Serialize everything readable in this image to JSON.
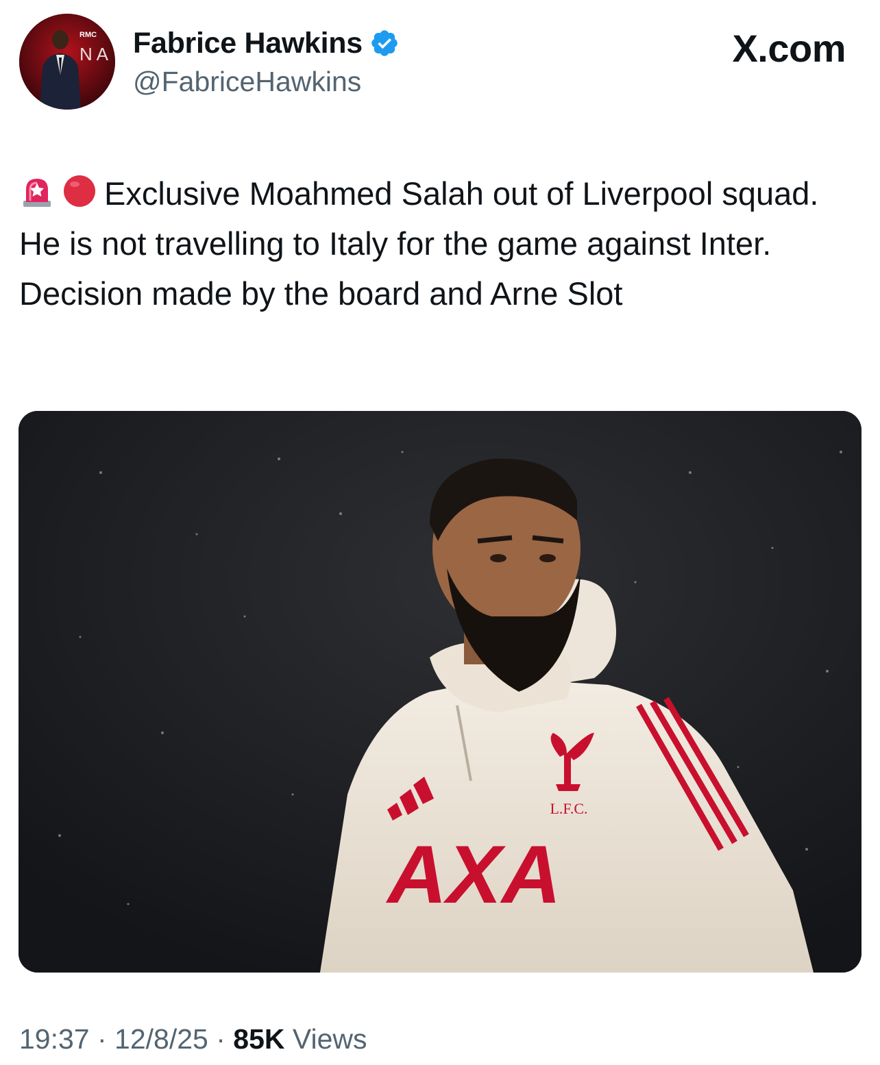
{
  "header": {
    "display_name": "Fabrice Hawkins",
    "handle": "@FabriceHawkins",
    "brand": "X.com",
    "avatar_sign_text": "N A",
    "avatar_logo_text": "RMC"
  },
  "tweet": {
    "text": "Exclusive Moahmed Salah out of Liverpool squad. He is not travelling to Italy for the game against Inter. Decision made by the board and Arne Slot",
    "emojis": [
      "rotating-light-icon",
      "red-circle-icon"
    ]
  },
  "media": {
    "crest_text": "L.F.C.",
    "sponsor_text": "AXA"
  },
  "meta": {
    "time": "19:37",
    "sep1": " · ",
    "date": "12/8/25",
    "sep2": " · ",
    "views_count": "85K",
    "views_label": " Views"
  },
  "colors": {
    "verified_blue": "#1d9bf0",
    "text_primary": "#0f1419",
    "text_secondary": "#536471",
    "liverpool_red": "#c8102e"
  }
}
